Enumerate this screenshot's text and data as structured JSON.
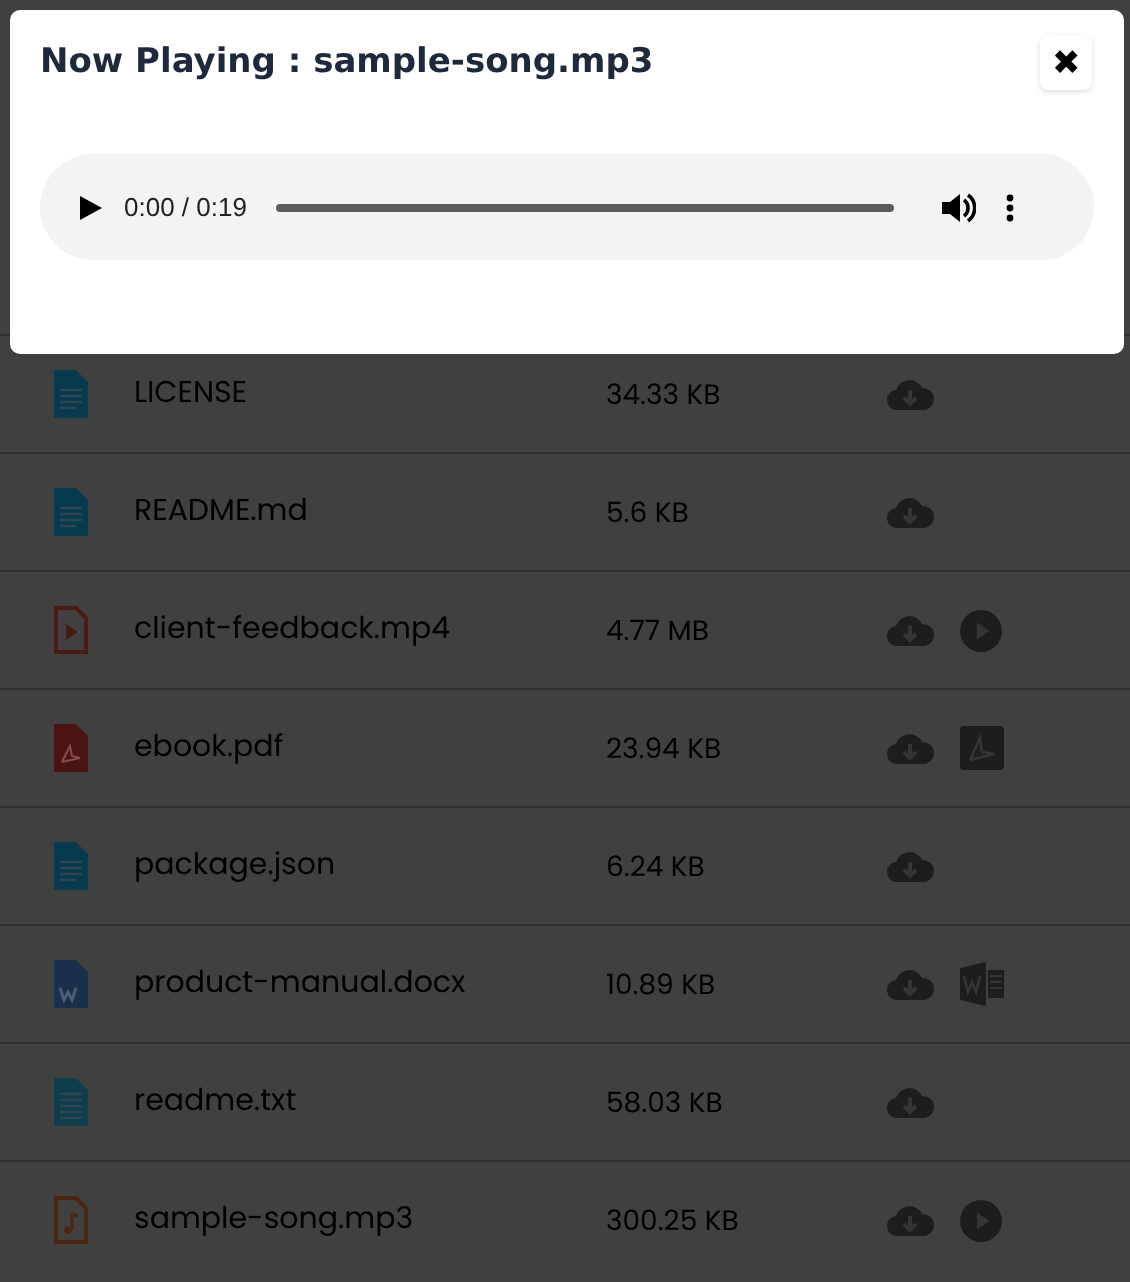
{
  "modal": {
    "title": "Now Playing : sample-song.mp3",
    "close": "✖",
    "player": {
      "time": "0:00 / 0:19"
    }
  },
  "files": [
    {
      "name": "LICENSE",
      "size": "34.33 KB",
      "kind": "doc",
      "actions": [
        {
          "kind": "download"
        }
      ]
    },
    {
      "name": "README.md",
      "size": "5.6 KB",
      "kind": "doc",
      "actions": [
        {
          "kind": "download"
        }
      ]
    },
    {
      "name": "client-feedback.mp4",
      "size": "4.77 MB",
      "kind": "video",
      "actions": [
        {
          "kind": "download"
        },
        {
          "kind": "play"
        }
      ]
    },
    {
      "name": "ebook.pdf",
      "size": "23.94 KB",
      "kind": "pdf",
      "actions": [
        {
          "kind": "download"
        },
        {
          "kind": "pdf"
        }
      ]
    },
    {
      "name": "package.json",
      "size": "6.24 KB",
      "kind": "doc",
      "actions": [
        {
          "kind": "download"
        }
      ]
    },
    {
      "name": "product-manual.docx",
      "size": "10.89 KB",
      "kind": "word",
      "actions": [
        {
          "kind": "download"
        },
        {
          "kind": "word"
        }
      ]
    },
    {
      "name": "readme.txt",
      "size": "58.03 KB",
      "kind": "text",
      "actions": [
        {
          "kind": "download"
        }
      ]
    },
    {
      "name": "sample-song.mp3",
      "size": "300.25 KB",
      "kind": "audio",
      "actions": [
        {
          "kind": "download"
        },
        {
          "kind": "play"
        }
      ]
    }
  ]
}
